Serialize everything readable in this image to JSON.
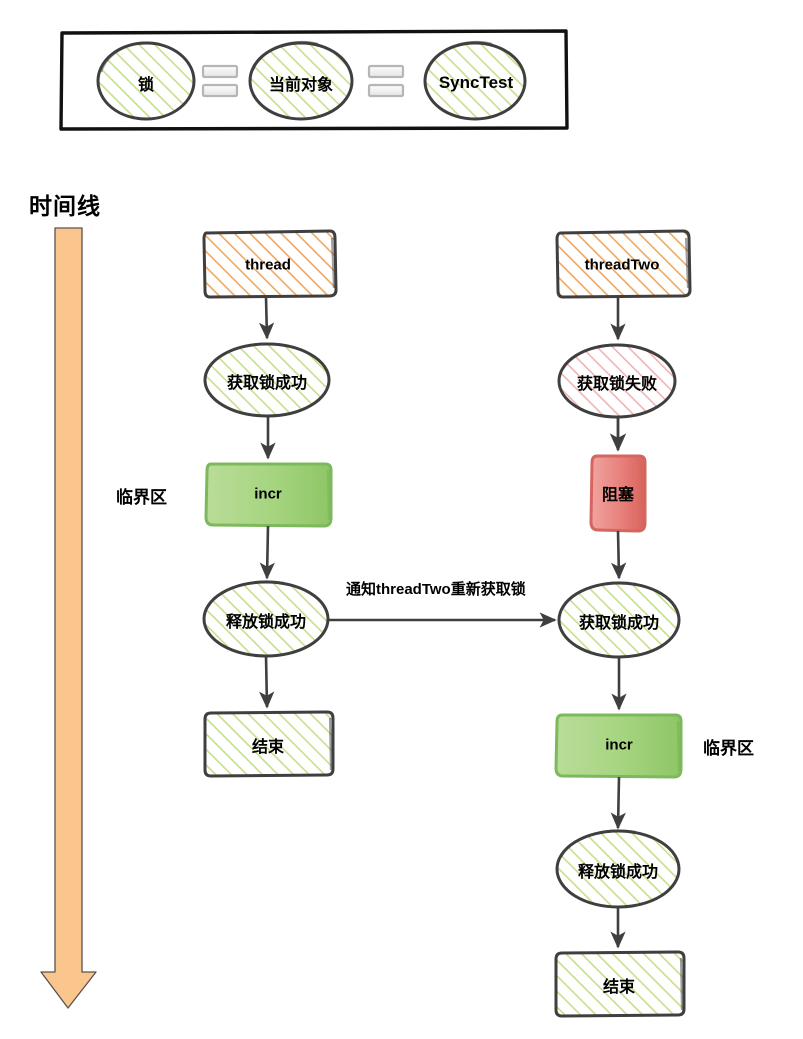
{
  "legend": {
    "items": [
      {
        "id": "lock",
        "label": "锁",
        "fill": "green-hatch"
      },
      {
        "id": "equals-1",
        "label": "=",
        "fill": "equals"
      },
      {
        "id": "current-object",
        "label": "当前对象",
        "fill": "green-hatch"
      },
      {
        "id": "equals-2",
        "label": "=",
        "fill": "equals"
      },
      {
        "id": "sync-test",
        "label": "SyncTest",
        "fill": "green-hatch"
      }
    ]
  },
  "timeline": {
    "label": "时间线",
    "arrow_color": "#fac68e"
  },
  "annotations": {
    "critical_section_left": "临界区",
    "critical_section_right": "临界区",
    "notify_edge": "通知threadTwo重新获取锁"
  },
  "colors": {
    "stroke": "#3f3f3f",
    "orange_hatch": "#f0a860",
    "green_hatch": "#c5e08a",
    "pink_hatch": "#f0b4b4",
    "green_solid": "#9ed37a",
    "red_solid": "#e4736d",
    "timeline_arrow": "#fac68e",
    "legend_border": "#111111"
  },
  "threads": {
    "left": {
      "name": "thread",
      "nodes": [
        {
          "id": "thread-start",
          "label": "thread",
          "shape": "box",
          "fill": "orange-hatch"
        },
        {
          "id": "acquire-lock-success",
          "label": "获取锁成功",
          "shape": "ellipse",
          "fill": "green-hatch"
        },
        {
          "id": "incr",
          "label": "incr",
          "shape": "box",
          "fill": "green-solid"
        },
        {
          "id": "release-lock-success",
          "label": "释放锁成功",
          "shape": "ellipse",
          "fill": "green-hatch"
        },
        {
          "id": "end",
          "label": "结束",
          "shape": "box",
          "fill": "green-hatch"
        }
      ]
    },
    "right": {
      "name": "threadTwo",
      "nodes": [
        {
          "id": "threadtwo-start",
          "label": "threadTwo",
          "shape": "box",
          "fill": "orange-hatch"
        },
        {
          "id": "acquire-lock-fail",
          "label": "获取锁失败",
          "shape": "ellipse",
          "fill": "pink-hatch"
        },
        {
          "id": "blocked",
          "label": "阻塞",
          "shape": "box",
          "fill": "red-solid"
        },
        {
          "id": "acquire-lock-success",
          "label": "获取锁成功",
          "shape": "ellipse",
          "fill": "green-hatch"
        },
        {
          "id": "incr",
          "label": "incr",
          "shape": "box",
          "fill": "green-solid"
        },
        {
          "id": "release-lock-success",
          "label": "释放锁成功",
          "shape": "ellipse",
          "fill": "green-hatch"
        },
        {
          "id": "end",
          "label": "结束",
          "shape": "box",
          "fill": "green-hatch"
        }
      ]
    }
  }
}
